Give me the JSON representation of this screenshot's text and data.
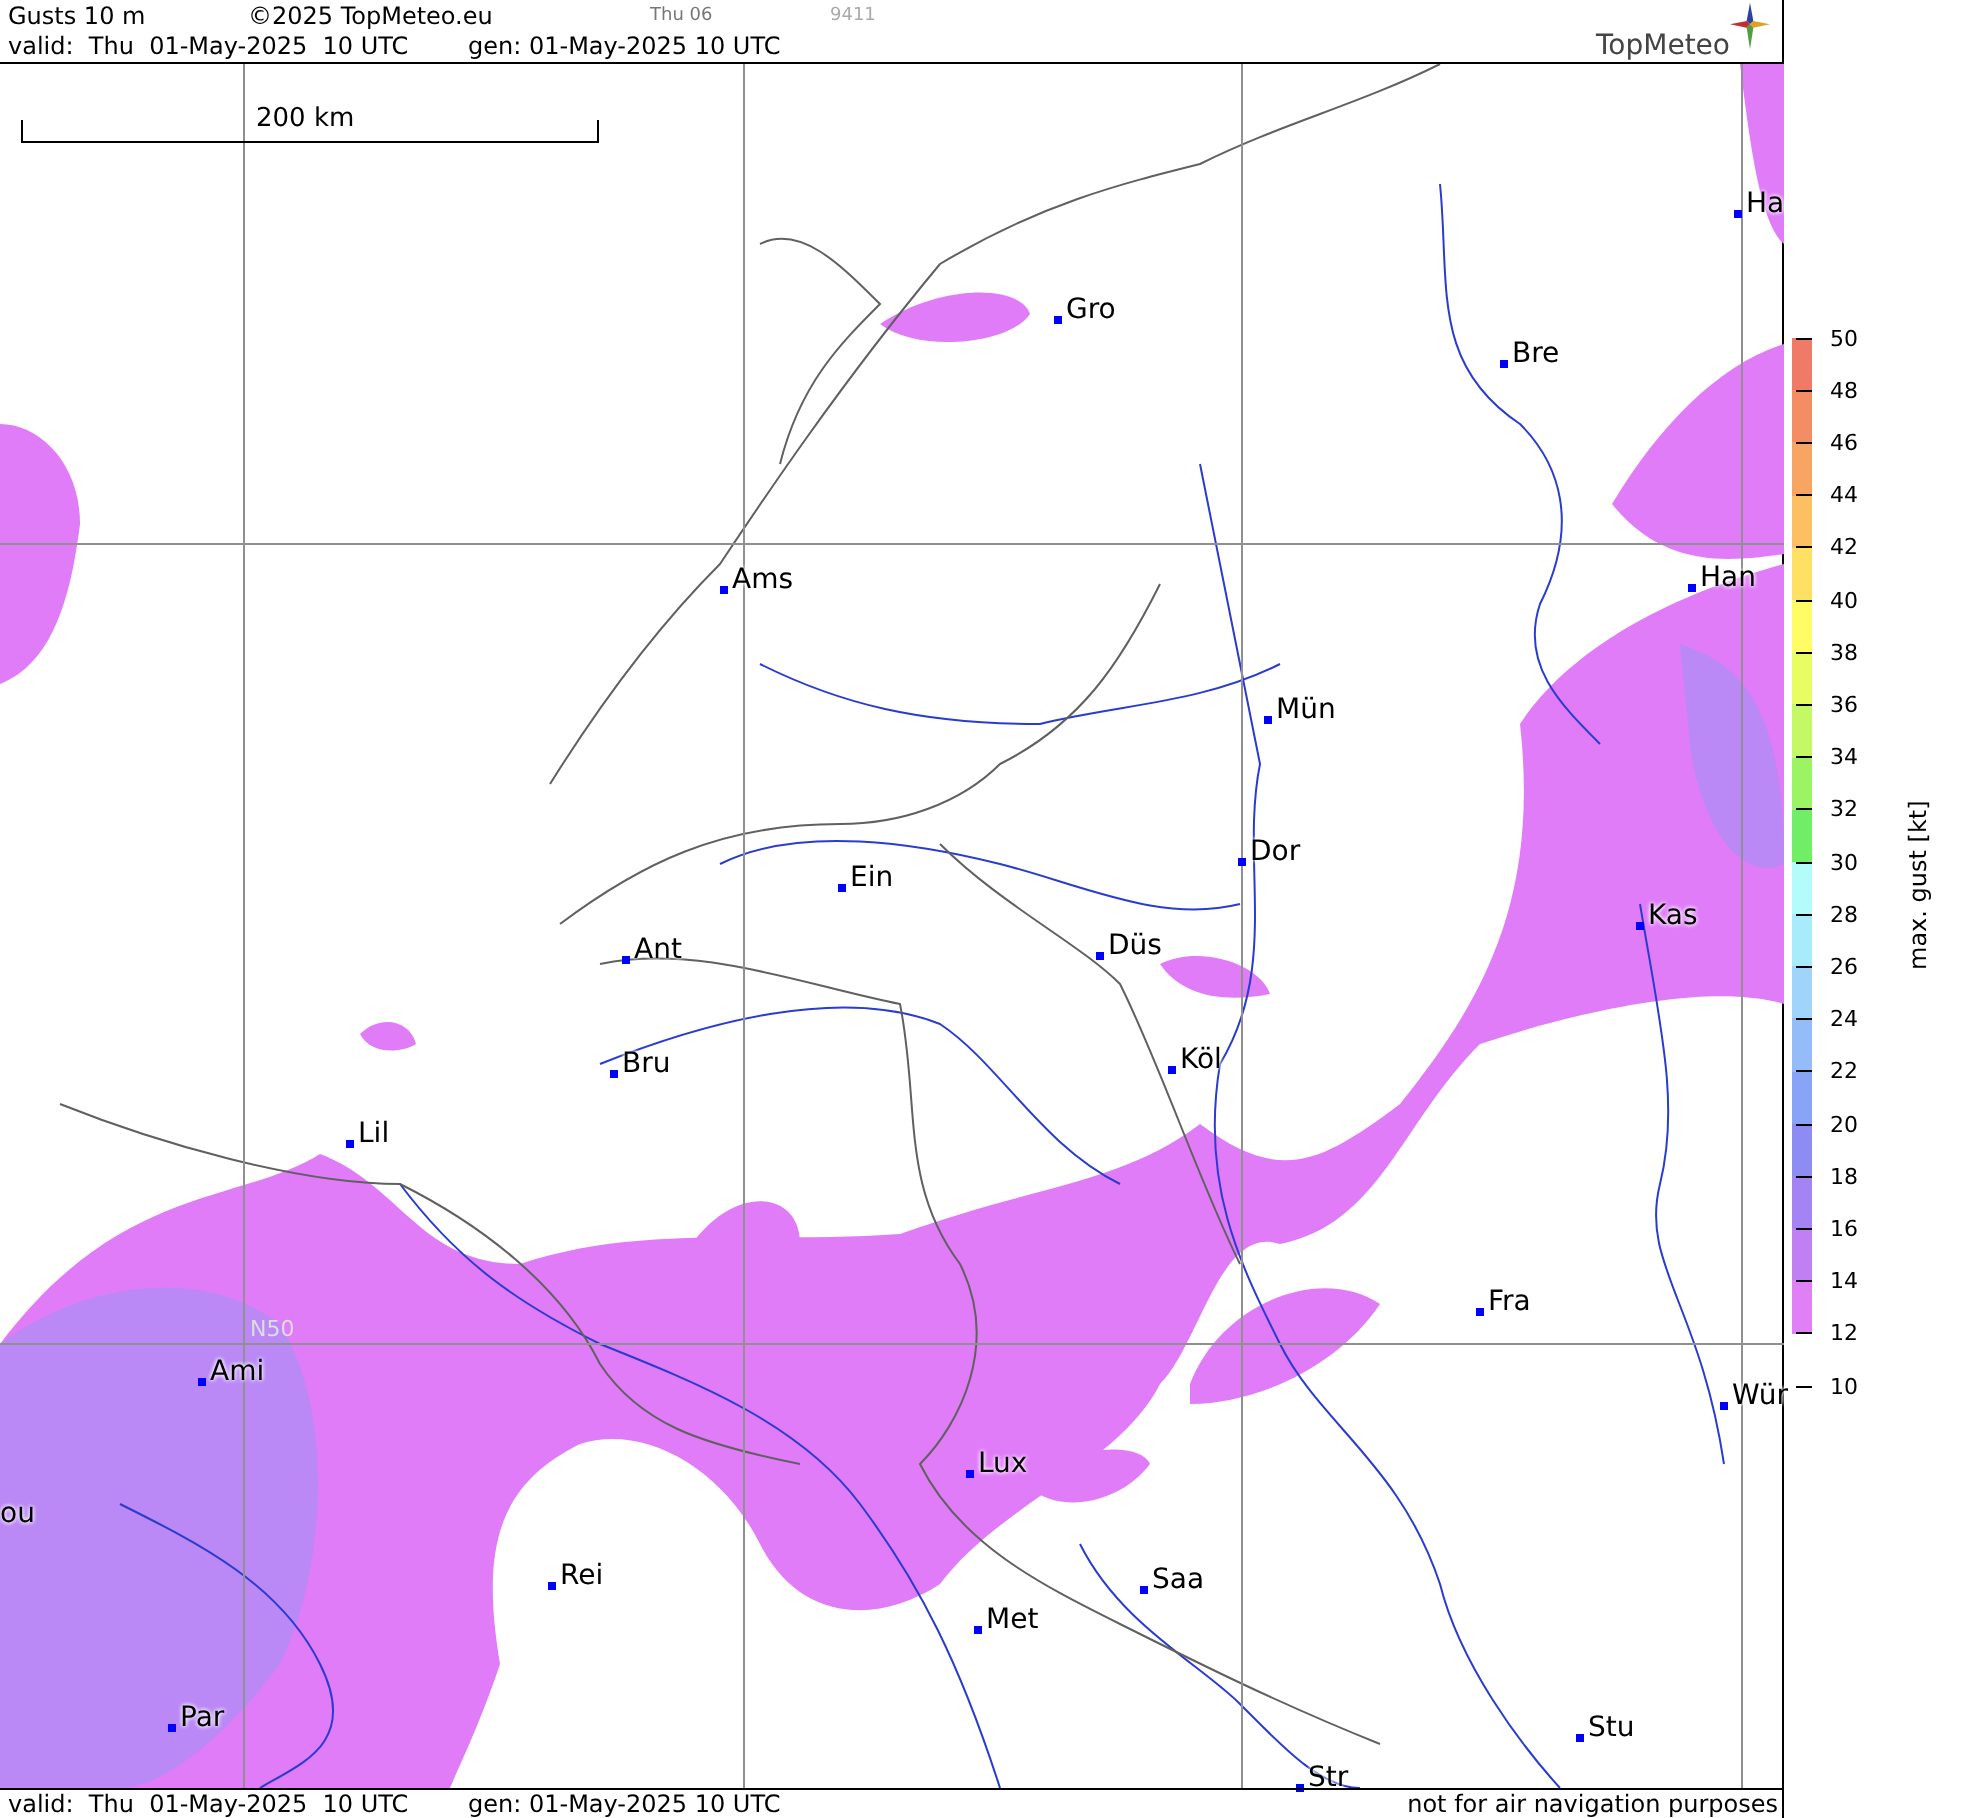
{
  "header": {
    "title": "Gusts 10 m",
    "copyright": "©2025 TopMeteo.eu",
    "run_day": "Thu 06",
    "code": "9411",
    "valid": "valid:  Thu  01-May-2025  10 UTC",
    "generated": "gen: 01-May-2025 10 UTC",
    "logo": "TopMeteo"
  },
  "map": {
    "scale": "200 km",
    "latitude_label": "N50",
    "cities": [
      {
        "name": "Ha"
      },
      {
        "name": "Gro"
      },
      {
        "name": "Bre"
      },
      {
        "name": "Ams"
      },
      {
        "name": "Han"
      },
      {
        "name": "Mün"
      },
      {
        "name": "Dor"
      },
      {
        "name": "Ein"
      },
      {
        "name": "Kas"
      },
      {
        "name": "Düs"
      },
      {
        "name": "Ant"
      },
      {
        "name": "Köl"
      },
      {
        "name": "Bru"
      },
      {
        "name": "Lil"
      },
      {
        "name": "Fra"
      },
      {
        "name": "Ami"
      },
      {
        "name": "Wür"
      },
      {
        "name": "Lux"
      },
      {
        "name": "ou",
        "marker": false
      },
      {
        "name": "Rei"
      },
      {
        "name": "Saa"
      },
      {
        "name": "Met"
      },
      {
        "name": "Stu"
      },
      {
        "name": "Par"
      },
      {
        "name": "Str"
      }
    ]
  },
  "legend": {
    "title": "max. gust [kt]",
    "ticks": [
      "50",
      "48",
      "46",
      "44",
      "42",
      "40",
      "38",
      "36",
      "34",
      "32",
      "30",
      "28",
      "26",
      "24",
      "22",
      "20",
      "18",
      "16",
      "14",
      "12",
      "10"
    ],
    "bands": [
      {
        "color": "#f07a68"
      },
      {
        "color": "#f48c64"
      },
      {
        "color": "#f8a462"
      },
      {
        "color": "#fcc062"
      },
      {
        "color": "#fee064"
      },
      {
        "color": "#fffc66"
      },
      {
        "color": "#e8fc64"
      },
      {
        "color": "#c4f864"
      },
      {
        "color": "#9cf464"
      },
      {
        "color": "#70ee66"
      },
      {
        "color": "#b4fcfc"
      },
      {
        "color": "#a8ecfc"
      },
      {
        "color": "#a0d4fa"
      },
      {
        "color": "#94bcf8"
      },
      {
        "color": "#88a4f6"
      },
      {
        "color": "#8c8cf4"
      },
      {
        "color": "#a484f4"
      },
      {
        "color": "#c080f4"
      },
      {
        "color": "#e080f6"
      }
    ]
  },
  "footer": {
    "valid": "valid:  Thu  01-May-2025  10 UTC",
    "generated": "gen: 01-May-2025 10 UTC",
    "notice": "not for air navigation purposes"
  }
}
